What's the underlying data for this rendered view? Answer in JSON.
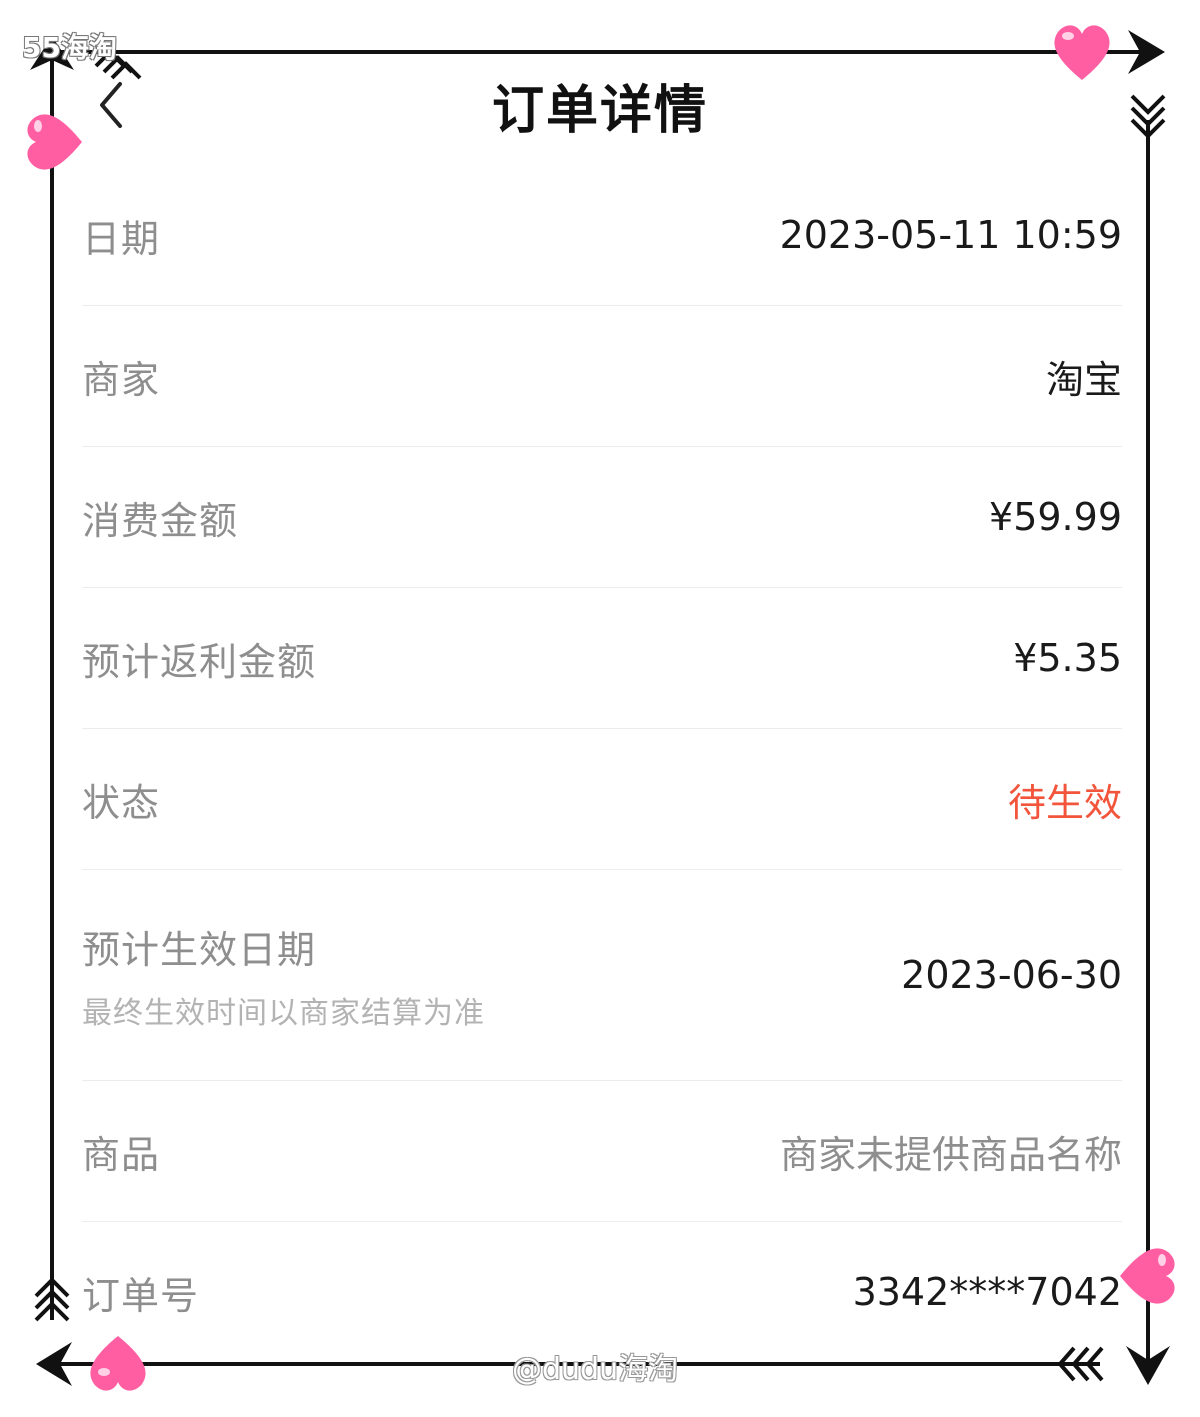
{
  "watermark": {
    "app_name": "55海淘",
    "author": "@dudu海淘"
  },
  "header": {
    "title": "订单详情",
    "back_icon": "chevron-left-icon"
  },
  "details": [
    {
      "label": "日期",
      "value": "2023-05-11 10:59"
    },
    {
      "label": "商家",
      "value": "淘宝"
    },
    {
      "label": "消费金额",
      "value": "¥59.99"
    },
    {
      "label": "预计返利金额",
      "value": "¥5.35"
    },
    {
      "label": "状态",
      "value": "待生效"
    },
    {
      "label": "预计生效日期",
      "sublabel": "最终生效时间以商家结算为准",
      "value": "2023-06-30"
    },
    {
      "label": "商品",
      "value": "商家未提供商品名称"
    },
    {
      "label": "订单号",
      "value": "3342****7042"
    }
  ],
  "colors": {
    "status": "#f2553b",
    "label": "#8e8e8e",
    "value": "#1a1a1a",
    "frame": "#111111",
    "heart": "#ff5fa2"
  }
}
